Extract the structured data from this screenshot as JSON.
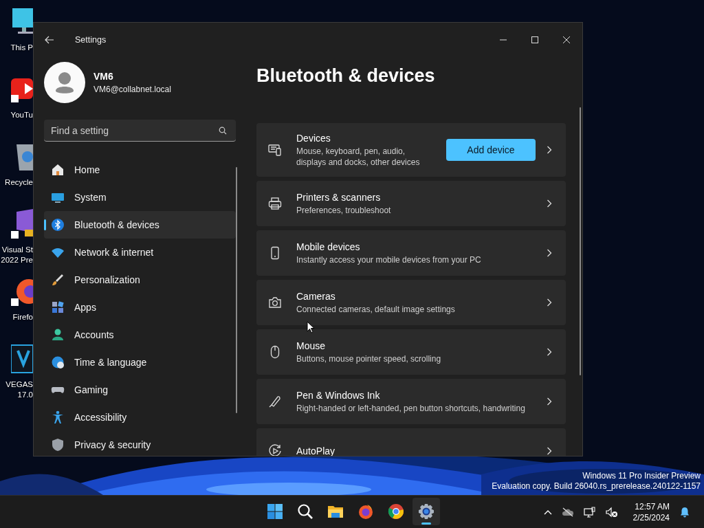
{
  "desktop": {
    "icons": [
      {
        "lines": [
          "This P"
        ]
      },
      {
        "lines": [
          "YouTu"
        ]
      },
      {
        "lines": [
          "Recycle"
        ]
      },
      {
        "lines": [
          "Visual St",
          "2022 Pre"
        ]
      },
      {
        "lines": [
          "Firefo"
        ]
      },
      {
        "lines": [
          "VEGAS",
          "17.0"
        ]
      }
    ]
  },
  "window": {
    "title": "Settings"
  },
  "user": {
    "name": "VM6",
    "email": "VM6@collabnet.local"
  },
  "search": {
    "placeholder": "Find a setting"
  },
  "sidebar": {
    "items": [
      {
        "label": "Home",
        "selected": false
      },
      {
        "label": "System",
        "selected": false
      },
      {
        "label": "Bluetooth & devices",
        "selected": true
      },
      {
        "label": "Network & internet",
        "selected": false
      },
      {
        "label": "Personalization",
        "selected": false
      },
      {
        "label": "Apps",
        "selected": false
      },
      {
        "label": "Accounts",
        "selected": false
      },
      {
        "label": "Time & language",
        "selected": false
      },
      {
        "label": "Gaming",
        "selected": false
      },
      {
        "label": "Accessibility",
        "selected": false
      },
      {
        "label": "Privacy & security",
        "selected": false
      }
    ]
  },
  "page": {
    "title": "Bluetooth & devices"
  },
  "cards": [
    {
      "title": "Devices",
      "subtitle": "Mouse, keyboard, pen, audio, displays and docks, other devices",
      "button": "Add device"
    },
    {
      "title": "Printers & scanners",
      "subtitle": "Preferences, troubleshoot"
    },
    {
      "title": "Mobile devices",
      "subtitle": "Instantly access your mobile devices from your PC"
    },
    {
      "title": "Cameras",
      "subtitle": "Connected cameras, default image settings"
    },
    {
      "title": "Mouse",
      "subtitle": "Buttons, mouse pointer speed, scrolling"
    },
    {
      "title": "Pen & Windows Ink",
      "subtitle": "Right-handed or left-handed, pen button shortcuts, handwriting"
    },
    {
      "title": "AutoPlay"
    }
  ],
  "build_info": {
    "lines": [
      "Windows 11 Pro Insider Preview",
      "Evaluation copy. Build 26040.rs_prerelease.240122-1157"
    ]
  },
  "taskbar": {
    "apps": [
      {
        "selected": false
      },
      {
        "selected": false
      },
      {
        "selected": false
      },
      {
        "selected": false
      },
      {
        "selected": false
      },
      {
        "selected": true
      }
    ]
  },
  "clock": {
    "time": "12:57 AM",
    "date": "2/25/2024"
  }
}
